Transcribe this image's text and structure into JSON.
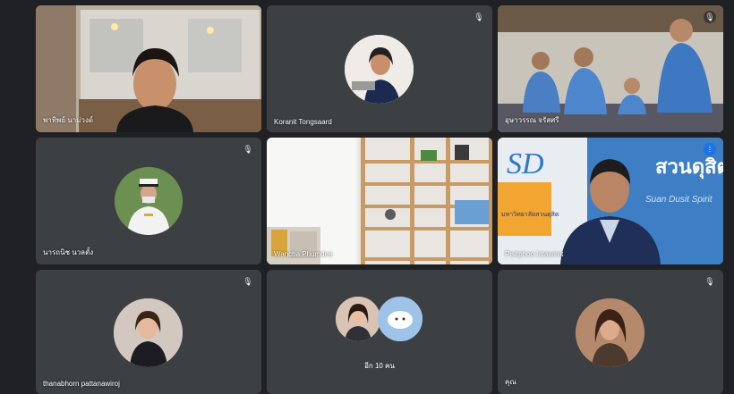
{
  "tiles": [
    {
      "name": "พาทิพย์ นาม่วงด์",
      "muted": false
    },
    {
      "name": "Koranit Tongsaard",
      "muted": true
    },
    {
      "name": "อุษาวรรณ จรัสศรี",
      "muted": true
    },
    {
      "name": "นารถนิช นวลตั้ง",
      "muted": true
    },
    {
      "name": "Wancha Phumdee",
      "muted": true
    },
    {
      "name": "Pisitphon Intawirat",
      "muted": false,
      "speaking": true
    },
    {
      "name": "thanabhorn pattanawiroj",
      "muted": true
    },
    {
      "name": "อีก 10 คน"
    },
    {
      "name": "คุณ",
      "muted": true
    }
  ],
  "banner": {
    "logo": "SD",
    "line1": "มหาวิทยาลัยสวนดุสิต",
    "word_th": "สวนดุสิต",
    "word_en": "Suan Dusit Spirit"
  },
  "icons": {
    "mic_off": "mic-off-icon",
    "speaking": "speaking-indicator-icon"
  },
  "colors": {
    "background": "#202124",
    "tile": "#3c4043",
    "active_outline": "#8ab4f8"
  }
}
